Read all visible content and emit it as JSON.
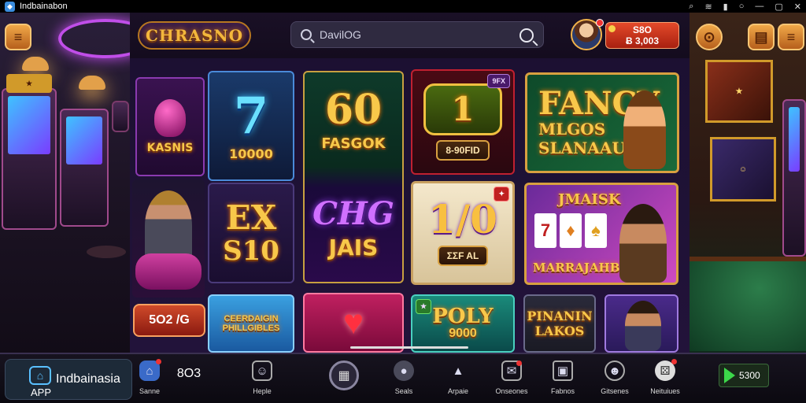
{
  "statusbar": {
    "app_name": "Indbainabon",
    "sys_icons": [
      "search-icon",
      "wifi-icon",
      "signal-icon",
      "battery-icon",
      "minimize-icon",
      "maximize-icon",
      "close-icon"
    ]
  },
  "topbar": {
    "logo": "CHRASNO",
    "search_value": "DavilOG",
    "balance_line1": "S8O",
    "balance_line2": "Ƀ 3,003"
  },
  "tiles": {
    "kasnis": "KASNIS",
    "seven_num": "7",
    "seven_label": "10000",
    "sixty_num": "60",
    "sixty_label": "FASGOK",
    "one_num": "1",
    "one_plaque": "8-90FID",
    "one_badge": "9FX",
    "fancy_title": "FANCY",
    "fancy_sub1": "MLGOS",
    "fancy_sub2": "SLANAAU",
    "ex_top": "EX",
    "ex_bottom": "S10",
    "ch_top": "CHG",
    "ch_bottom": "JAIS",
    "one_zero": "1/0",
    "one_zero_plaque": "ƩΣF AL",
    "jmaisk_title": "JMAISK",
    "jmaisk_sub": "MARRAJAHB",
    "promo_label": "5O2 /G",
    "cerrdaion_top": "CEERDAIGIN",
    "cerrdaion_bottom": "PHILLGIBLES",
    "poly_top": "POLY",
    "poly_bottom": "9000",
    "pinanin_top": "PINANIN",
    "pinanin_bottom": "LAKOS"
  },
  "bottom": {
    "brand_name": "Indbainasia",
    "brand_sub": "APP",
    "nav": [
      {
        "label": "Sanne",
        "icon": "home-icon",
        "text": ""
      },
      {
        "label": "",
        "icon": "",
        "text": "8O3"
      },
      {
        "label": "Heple",
        "icon": "chat-icon",
        "text": ""
      },
      {
        "label": "Seals",
        "icon": "coin-icon",
        "text": ""
      },
      {
        "label": "Arpaie",
        "icon": "up-arrow-icon",
        "text": ""
      },
      {
        "label": "Onseones",
        "icon": "message-icon",
        "text": ""
      },
      {
        "label": "Fabnos",
        "icon": "gift-icon",
        "text": ""
      },
      {
        "label": "Gitsenes",
        "icon": "face-icon",
        "text": ""
      },
      {
        "label": "Neituiues",
        "icon": "dice-icon",
        "text": ""
      }
    ],
    "play_label": "5300"
  },
  "colors": {
    "accent_gold": "#f8c84a",
    "balance_red": "#d2321a",
    "play_green": "#3cd84a"
  }
}
